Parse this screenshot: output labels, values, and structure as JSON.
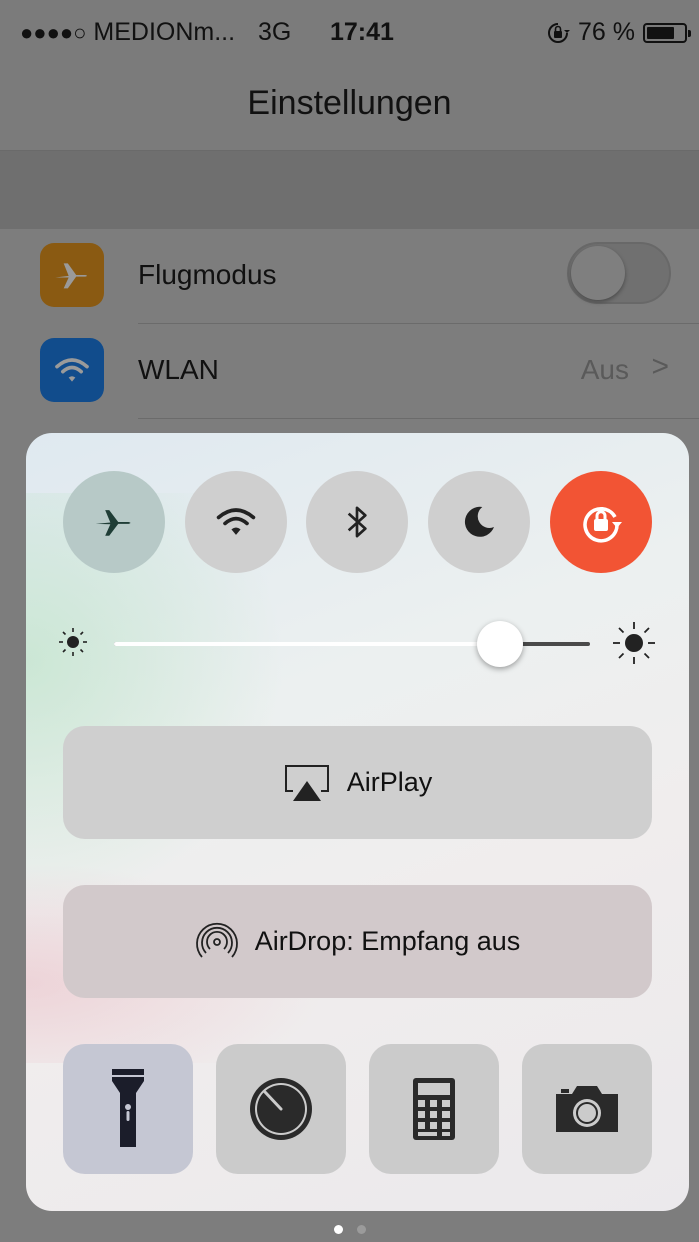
{
  "status_bar": {
    "signal_dots": "●●●●○",
    "carrier": "MEDIONm...",
    "network": "3G",
    "time": "17:41",
    "battery_text": "76 %",
    "battery_level": 0.76,
    "lock_icon": "rotation-lock-icon"
  },
  "settings": {
    "title": "Einstellungen",
    "rows": [
      {
        "label": "Flugmodus",
        "icon": "airplane-icon",
        "icon_color": "#8a5a12",
        "toggle_on": false
      },
      {
        "label": "WLAN",
        "icon": "wifi-icon",
        "icon_color": "#114c8c",
        "value": "Aus",
        "chevron": ">"
      }
    ]
  },
  "control_center": {
    "toggles": [
      {
        "name": "airplane-mode",
        "icon": "airplane-icon",
        "active": true
      },
      {
        "name": "wifi",
        "icon": "wifi-icon",
        "active": false
      },
      {
        "name": "bluetooth",
        "icon": "bluetooth-icon",
        "active": false
      },
      {
        "name": "do-not-disturb",
        "icon": "moon-icon",
        "active": false
      },
      {
        "name": "rotation-lock",
        "icon": "rotation-lock-icon",
        "active": true,
        "color": "#f25434"
      }
    ],
    "brightness": {
      "value": 0.81
    },
    "airplay_label": "AirPlay",
    "airdrop_label": "AirDrop: Empfang aus",
    "shortcuts": [
      {
        "name": "flashlight",
        "icon": "flashlight-icon"
      },
      {
        "name": "timer",
        "icon": "timer-icon"
      },
      {
        "name": "calculator",
        "icon": "calculator-icon"
      },
      {
        "name": "camera",
        "icon": "camera-icon"
      }
    ],
    "page_count": 2,
    "current_page": 1
  }
}
